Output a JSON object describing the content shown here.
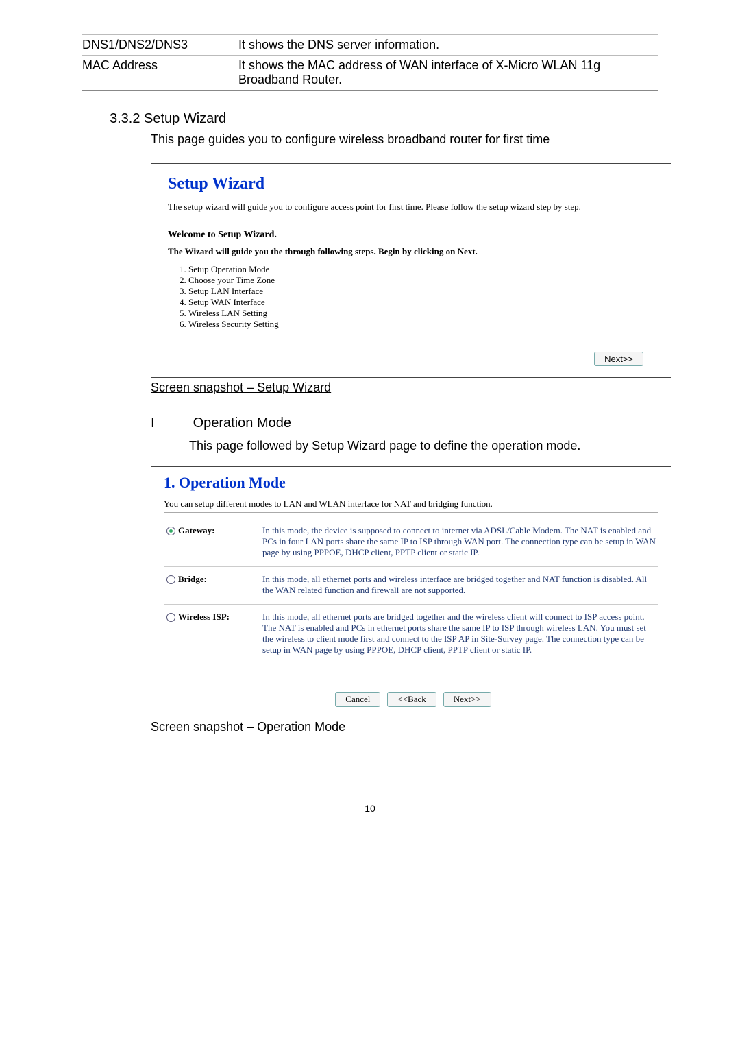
{
  "info_table": [
    {
      "label": "DNS1/DNS2/DNS3",
      "value": "It shows the DNS server information."
    },
    {
      "label": "MAC Address",
      "value": "It shows the MAC address of WAN interface of X-Micro WLAN 11g Broadband Router."
    }
  ],
  "section": {
    "heading": "3.3.2 Setup Wizard",
    "description": "This page guides you to configure wireless broadband router for first time"
  },
  "setup_wizard": {
    "title": "Setup Wizard",
    "intro": "The setup wizard will guide you to configure access point for first time. Please follow the setup wizard step by step.",
    "welcome": "Welcome to Setup Wizard.",
    "guide": "The Wizard will guide you the through following steps. Begin by clicking on Next.",
    "steps": [
      "Setup Operation Mode",
      "Choose your Time Zone",
      "Setup LAN Interface",
      "Setup WAN Interface",
      "Wireless LAN Setting",
      "Wireless Security Setting"
    ],
    "next_label": "Next>>"
  },
  "caption1": "Screen snapshot – Setup Wizard",
  "operation_mode_section": {
    "index": "I",
    "title": "Operation Mode",
    "description": "This page followed by Setup Wizard page to define the operation mode."
  },
  "operation_mode": {
    "title": "1. Operation Mode",
    "intro": "You can setup different modes to LAN and WLAN interface for NAT and bridging function.",
    "options": [
      {
        "label": "Gateway:",
        "selected": true,
        "text": "In this mode, the device is supposed to connect to internet via ADSL/Cable Modem. The NAT is enabled and PCs in four LAN ports share the same IP to ISP through WAN port. The connection type can be setup in WAN page by using PPPOE, DHCP client, PPTP client or static IP."
      },
      {
        "label": "Bridge:",
        "selected": false,
        "text": "In this mode, all ethernet ports and wireless interface are bridged together and NAT function is disabled. All the WAN related function and firewall are not supported."
      },
      {
        "label": "Wireless ISP:",
        "selected": false,
        "text": "In this mode, all ethernet ports are bridged together and the wireless client will connect to ISP access point. The NAT is enabled and PCs in ethernet ports share the same IP to ISP through wireless LAN. You must set the wireless to client mode first and connect to the ISP AP in Site-Survey page. The connection type can be setup in WAN page by using PPPOE, DHCP client, PPTP client or static IP."
      }
    ],
    "cancel_label": "Cancel",
    "back_label": "<<Back",
    "next_label": "Next>>"
  },
  "caption2": "Screen snapshot – Operation Mode",
  "page_number": "10"
}
